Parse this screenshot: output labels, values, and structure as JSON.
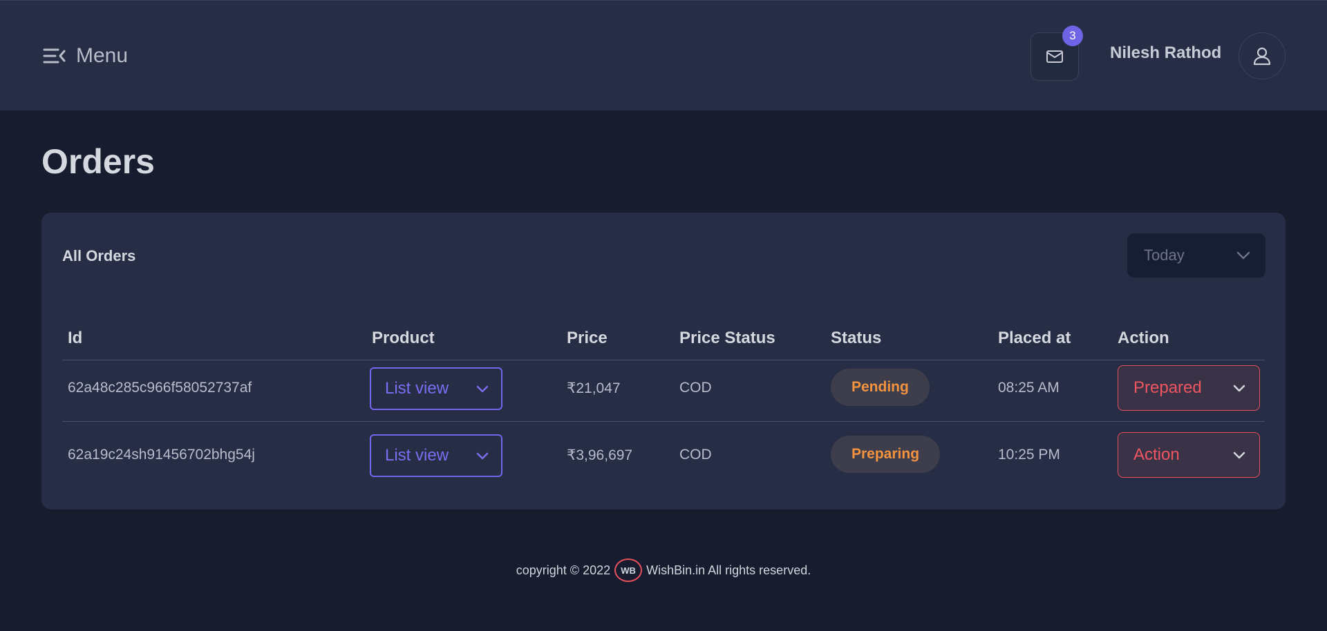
{
  "header": {
    "menu_label": "Menu",
    "notification_count": "3",
    "user_name": "Nilesh Rathod"
  },
  "page": {
    "title": "Orders"
  },
  "orders_card": {
    "title": "All Orders",
    "filter_value": "Today",
    "columns": [
      "Id",
      "Product",
      "Price",
      "Price Status",
      "Status",
      "Placed at",
      "Action"
    ],
    "rows": [
      {
        "id": "62a48c285c966f58052737af",
        "product": "List view",
        "price": "₹21,047",
        "price_status": "COD",
        "status": "Pending",
        "placed_at": "08:25 AM",
        "action": "Prepared"
      },
      {
        "id": "62a19c24sh91456702bhg54j",
        "product": "List view",
        "price": "₹3,96,697",
        "price_status": "COD",
        "status": "Preparing",
        "placed_at": "10:25 PM",
        "action": "Action"
      }
    ]
  },
  "footer": {
    "copyright_prefix": "copyright © 2022",
    "logo_text": "WB",
    "copyright_suffix": "WishBin.in All rights reserved."
  },
  "colors": {
    "accent": "#7166f0",
    "danger": "#e8505b",
    "warning": "#f4933d",
    "background": "#171c2f",
    "surface": "#262d44"
  },
  "icons": {
    "menu": "menu-collapse-icon",
    "mail": "mail-icon",
    "user": "user-icon",
    "chevron": "chevron-down-icon"
  }
}
